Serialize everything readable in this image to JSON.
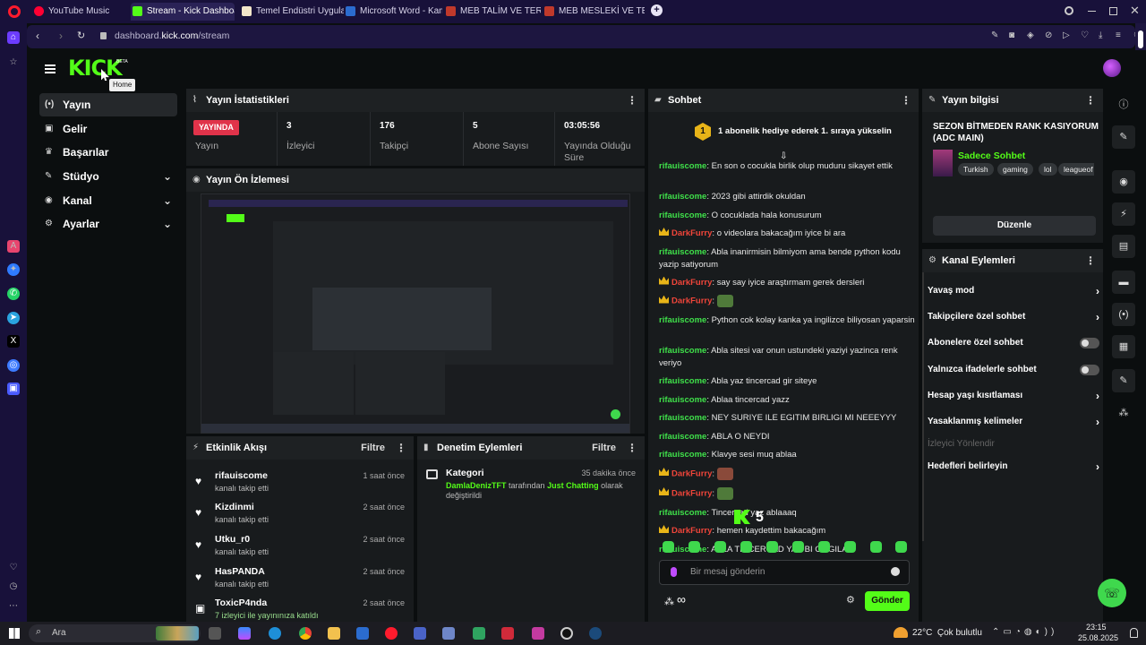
{
  "browser": {
    "tabs": [
      {
        "label": "YouTube Music",
        "color": "#ff0033"
      },
      {
        "label": "Stream - Kick Dashboard",
        "color": "#53fc18"
      },
      {
        "label": "Temel Endüstri Uygulamal",
        "color": "#f2e6c9"
      },
      {
        "label": "Microsoft Word - Kamaral",
        "color": "#2b6ccf"
      },
      {
        "label": "MEB TALİM VE TERBİYE K",
        "color": "#c0392b"
      },
      {
        "label": "MEB MESLEKİ VE TEKNİK",
        "color": "#c0392b"
      }
    ],
    "url_prefix": "dashboard.",
    "url_domain": "kick.com",
    "url_path": "/stream",
    "plus": "+"
  },
  "header": {
    "logo": "KICK",
    "beta": "BETA",
    "tooltip": "Home"
  },
  "nav": {
    "items": [
      {
        "label": "Yayın",
        "active": true
      },
      {
        "label": "Gelir"
      },
      {
        "label": "Başarılar"
      },
      {
        "label": "Stüdyo",
        "chevron": true
      },
      {
        "label": "Kanal",
        "chevron": true
      },
      {
        "label": "Ayarlar",
        "chevron": true
      }
    ]
  },
  "stats": {
    "title": "Yayın İstatistikleri",
    "live_badge": "YAYINDA",
    "items": [
      {
        "value": "YAYINDA",
        "label": "Yayın"
      },
      {
        "value": "3",
        "label": "İzleyici"
      },
      {
        "value": "176",
        "label": "Takipçi"
      },
      {
        "value": "5",
        "label": "Abone Sayısı"
      },
      {
        "value": "03:05:56",
        "label": "Yayında Olduğu Süre"
      }
    ]
  },
  "preview": {
    "title": "Yayın Ön İzlemesi"
  },
  "activity": {
    "title": "Etkinlik Akışı",
    "filter": "Filtre",
    "items": [
      {
        "name": "rifauiscome",
        "sub": "kanalı takip etti",
        "time": "1 saat önce"
      },
      {
        "name": "Kizdinmi",
        "sub": "kanalı takip etti",
        "time": "2 saat önce"
      },
      {
        "name": "Utku_r0",
        "sub": "kanalı takip etti",
        "time": "2 saat önce"
      },
      {
        "name": "HasPANDA",
        "sub": "kanalı takip etti",
        "time": "2 saat önce"
      },
      {
        "name": "ToxicP4nda",
        "sub": "7 izleyici ile yayınınıza katıldı",
        "time": "2 saat önce"
      }
    ]
  },
  "moderation": {
    "title": "Denetim Eylemleri",
    "filter": "Filtre",
    "item": {
      "title": "Kategori",
      "time": "35 dakika önce",
      "user": "DamlaDenizTFT",
      "mid": " tarafından ",
      "category": "Just Chatting",
      "end": " olarak değiştirildi"
    }
  },
  "chat": {
    "title": "Sohbet",
    "pinned_rank": "1",
    "pinned": "1 abonelik hediye ederek 1. sıraya yükselin",
    "messages": [
      {
        "user": "rifauiscome",
        "text": "En son o cocukla birlik olup muduru sikayet ettik"
      },
      {
        "user": "rifauiscome",
        "text": "2023 gibi attirdik okuldan"
      },
      {
        "user": "rifauiscome",
        "text": "O cocuklada hala konusurum"
      },
      {
        "user": "DarkFurry",
        "text": "o videolara bakacağım iyice bi ara",
        "crown": true
      },
      {
        "user": "rifauiscome",
        "text": "Abla inanirmisin bilmiyom ama bende python kodu yazip satiyorum"
      },
      {
        "user": "DarkFurry",
        "text": "say say iyice araştırmam gerek dersleri",
        "crown": true
      },
      {
        "user": "DarkFurry",
        "text": "",
        "crown": true,
        "emote": true
      },
      {
        "user": "rifauiscome",
        "text": "Python cok kolay kanka ya ingilizce biliyosan yaparsin"
      },
      {
        "user": "rifauiscome",
        "text": "Abla sitesi var onun ustundeki yaziyi yazinca renk veriyo"
      },
      {
        "user": "rifauiscome",
        "text": "Abla yaz tincercad gir siteye"
      },
      {
        "user": "rifauiscome",
        "text": "Ablaa tincercad yazz"
      },
      {
        "user": "rifauiscome",
        "text": "NEY SURIYE ILE EGITIM BIRLIGI MI NEEEYYY"
      },
      {
        "user": "rifauiscome",
        "text": "ABLA O NEYDI"
      },
      {
        "user": "rifauiscome",
        "text": "Klavye sesi muq ablaa"
      },
      {
        "user": "DarkFurry",
        "text": "",
        "crown": true,
        "emote": true
      },
      {
        "user": "DarkFurry",
        "text": "",
        "crown": true,
        "emote": true
      },
      {
        "user": "rifauiscome",
        "text": "Tincercad yaz ablaaaq"
      },
      {
        "user": "DarkFurry",
        "text": "hemen kaydettim bakacağım",
        "crown": true
      },
      {
        "user": "rifauiscome",
        "text": "ABLA TINCERCAD YAZ BI GOGILA"
      }
    ],
    "overlay_count": "5",
    "placeholder": "Bir mesaj gönderin",
    "infinity": "∞",
    "send": "Gönder"
  },
  "stream_info": {
    "title": "Yayın bilgisi",
    "stream_title": "SEZON BİTMEDEN RANK KASIYORUM (ADC MAIN)",
    "category": "Sadece Sohbet",
    "tags": [
      "Turkish",
      "gaming",
      "lol",
      "leagueof"
    ],
    "edit": "Düzenle"
  },
  "channel_actions": {
    "title": "Kanal Eylemleri",
    "items": [
      {
        "label": "Yavaş mod",
        "kind": "chevron"
      },
      {
        "label": "Takipçilere özel sohbet",
        "kind": "chevron"
      },
      {
        "label": "Abonelere özel sohbet",
        "kind": "toggle"
      },
      {
        "label": "Yalnızca ifadelerle sohbet",
        "kind": "toggle"
      },
      {
        "label": "Hesap yaşı kısıtlaması",
        "kind": "chevron"
      },
      {
        "label": "Yasaklanmış kelimeler",
        "kind": "chevron"
      },
      {
        "label": "İzleyici Yönlendir",
        "kind": "disabled"
      },
      {
        "label": "Hedefleri belirleyin",
        "kind": "chevron"
      }
    ]
  },
  "taskbar": {
    "search": "Ara",
    "weather": "22°C  Çok bulutlu",
    "time": "23:15",
    "date": "25.08.2025"
  },
  "colors": {
    "kick_green": "#53fc18",
    "accent_red": "#e0334a"
  }
}
